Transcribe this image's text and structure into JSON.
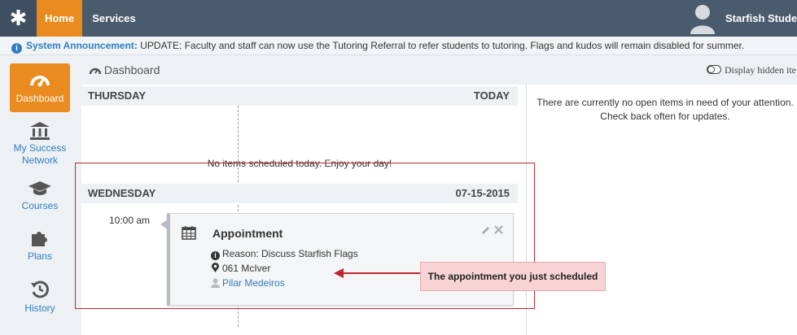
{
  "topbar": {
    "home_label": "Home",
    "services_label": "Services",
    "user_name": "Starfish Student"
  },
  "announcement": {
    "label": "System Announcement:",
    "text": " UPDATE: Faculty and staff can now use the Tutoring Referral to refer students to tutoring. Flags and kudos will remain disabled for summer."
  },
  "sidebar": {
    "items": [
      {
        "label": "Dashboard",
        "icon": "speedometer-icon",
        "active": true
      },
      {
        "label": "My Success Network",
        "icon": "institution-icon",
        "active": false
      },
      {
        "label": "Courses",
        "icon": "graduation-cap-icon",
        "active": false
      },
      {
        "label": "Plans",
        "icon": "puzzle-icon",
        "active": false
      },
      {
        "label": "History",
        "icon": "history-icon",
        "active": false
      }
    ]
  },
  "dashboard": {
    "title": "Dashboard",
    "hidden_toggle": "Display hidden ite"
  },
  "days": [
    {
      "name": "THURSDAY",
      "right": "TODAY",
      "empty_message": "No items scheduled today. Enjoy your day!"
    },
    {
      "name": "WEDNESDAY",
      "right": "07-15-2015"
    }
  ],
  "appointment": {
    "time": "10:00 am",
    "title": "Appointment",
    "reason": "Reason: Discuss Starfish Flags",
    "location": "061 McIver",
    "person": "Pilar Medeiros"
  },
  "callout": {
    "text": "The appointment you just scheduled"
  },
  "right_panel": {
    "line1": "There are currently no open items in need of your attention.",
    "line2": "Check back often for updates."
  },
  "colors": {
    "accent": "#e98b1f",
    "link": "#2f7dc1",
    "topbar": "#4a5b6e",
    "highlight": "#c0272d"
  }
}
